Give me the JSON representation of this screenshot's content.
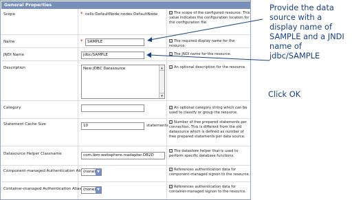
{
  "panel": {
    "header": "General Properties",
    "rows": {
      "scope": {
        "label": "Scope",
        "value": "cells:DefaultNode:nodes:DefaultNode",
        "desc": "The scope of the configured resource. This value indicates the configuration location for the configuration file."
      },
      "name": {
        "label": "Name",
        "value": "SAMPLE",
        "desc": "The required display name for the resource."
      },
      "jndi": {
        "label": "JNDI Name",
        "value": "jdbc/SAMPLE",
        "desc": "The JNDI name for the resource."
      },
      "description": {
        "label": "Description",
        "value": "New JDBC Datasource",
        "desc": "An optional description for the resource."
      },
      "category": {
        "label": "Category",
        "value": "",
        "desc": "An optional category string which can be used to classify or group the resource."
      },
      "cache": {
        "label": "Statement Cache Size",
        "value": "10",
        "unit": "statements",
        "desc": "Number of free prepared statements per connection. This is different from the old datasource which is defined as number of free prepared statements per data source."
      },
      "helper": {
        "label": "Datasource Helper Classname",
        "value": "com.ibm.websphere.rsadapter.DB2D",
        "desc": "The datastore helper that is used to perform specific database functions."
      },
      "component_alias": {
        "label": "Component-managed Authentication Alias",
        "value": "(none)",
        "desc": "References authentication data for component-managed signon to the resource."
      },
      "container_alias": {
        "label": "Container-managed Authentication Alias",
        "value": "(none)",
        "desc": "References authentication data for container-managed signon to the resource."
      }
    }
  },
  "annotation": {
    "note": "Provide the data source with a display name of SAMPLE and a JNDI name of jdbc/SAMPLE",
    "action": "Click OK",
    "color": "#173f86"
  },
  "icons": {
    "info": "info-icon",
    "required": "required-asterisk",
    "dropdown": "chevron-down-icon",
    "arrow": "arrow-left-icon"
  }
}
